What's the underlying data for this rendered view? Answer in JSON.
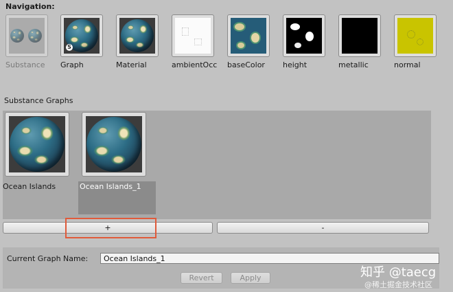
{
  "navigation": {
    "title": "Navigation:",
    "items": [
      {
        "label": "Substance",
        "kind": "substance-icon"
      },
      {
        "label": "Graph",
        "kind": "globe"
      },
      {
        "label": "Material",
        "kind": "globe"
      },
      {
        "label": "ambientOcc",
        "kind": "ao-map"
      },
      {
        "label": "baseColor",
        "kind": "basecolor-map"
      },
      {
        "label": "height",
        "kind": "height-map"
      },
      {
        "label": "metallic",
        "kind": "metallic-map"
      },
      {
        "label": "normal",
        "kind": "normal-map"
      }
    ]
  },
  "graphs": {
    "title": "Substance Graphs",
    "items": [
      {
        "label": "Ocean Islands",
        "selected": false
      },
      {
        "label": "Ocean Islands_1",
        "selected": true
      }
    ],
    "add_label": "+",
    "remove_label": "-"
  },
  "current_graph": {
    "label": "Current Graph Name:",
    "value": "Ocean Islands_1",
    "revert_label": "Revert",
    "apply_label": "Apply"
  },
  "watermark": {
    "text": "知乎 @taecg",
    "subtext": "@稀土掘金技术社区"
  },
  "colors": {
    "highlight": "#e05a3a",
    "selection": "#8b8b8b"
  }
}
